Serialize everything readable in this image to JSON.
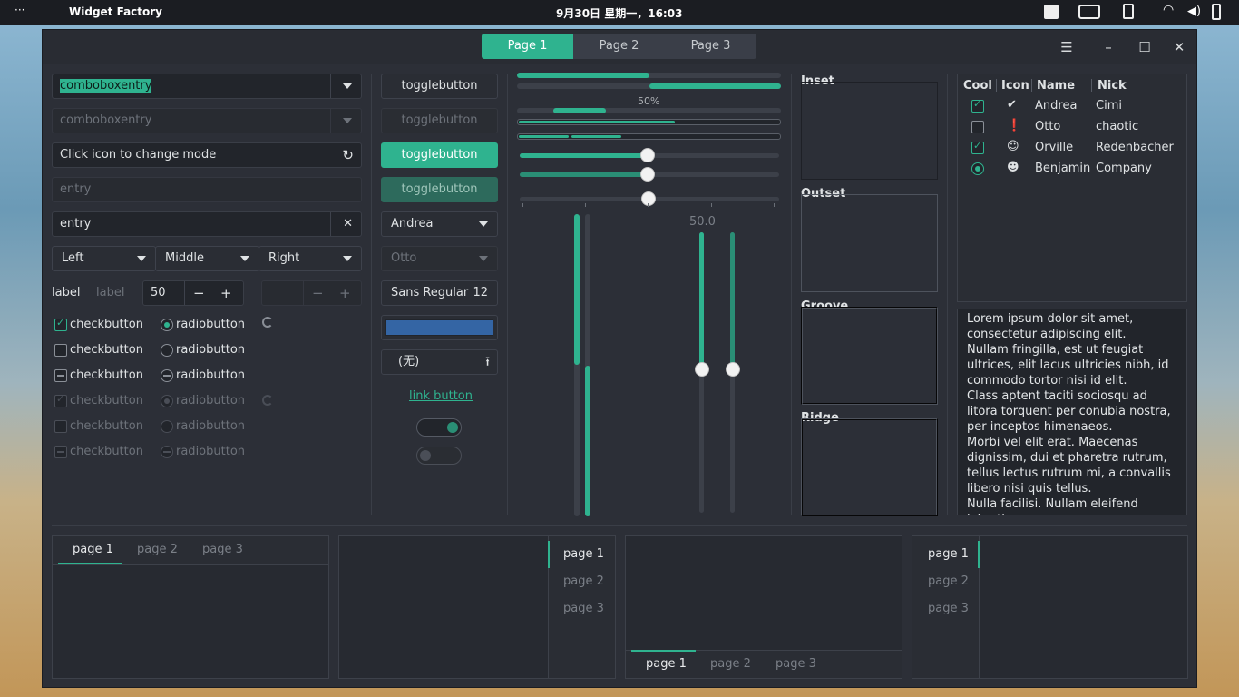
{
  "topbar": {
    "apps_label": "···",
    "app_name": "Widget Factory",
    "clock": "9月30日 星期一，16:03"
  },
  "header": {
    "stack": [
      "Page 1",
      "Page 2",
      "Page 3"
    ],
    "menu_icon": "☰",
    "min_icon": "–",
    "max_icon": "☐",
    "close_icon": "✕"
  },
  "col1": {
    "combo1": "comboboxentry",
    "combo2": "comboboxentry",
    "entry_mode": "Click icon to change mode",
    "entry_dis": "entry",
    "entry_val": "entry",
    "seg": [
      "Left",
      "Middle",
      "Right"
    ],
    "label1": "label",
    "label2": "label",
    "spin_val": "50",
    "minus": "−",
    "plus": "+",
    "checks": [
      "checkbutton",
      "checkbutton",
      "checkbutton",
      "checkbutton",
      "checkbutton",
      "checkbutton"
    ],
    "radios": [
      "radiobutton",
      "radiobutton",
      "radiobutton",
      "radiobutton",
      "radiobutton",
      "radiobutton"
    ]
  },
  "col2": {
    "toggles": [
      "togglebutton",
      "togglebutton",
      "togglebutton",
      "togglebutton"
    ],
    "combo_a": "Andrea",
    "combo_b": "Otto",
    "font": "Sans Regular",
    "font_size": "12",
    "file": "(无)",
    "link": "link button"
  },
  "col3": {
    "progress_label": "50%",
    "scale_value": "50.0",
    "progress_fraction": 0.5
  },
  "frames": {
    "inset": "Inset",
    "outset": "Outset",
    "groove": "Groove",
    "ridge": "Ridge"
  },
  "tree": {
    "headers": [
      "Cool",
      "Icon",
      "Name",
      "Nick"
    ],
    "rows": [
      {
        "name": "Andrea",
        "nick": "Cimi"
      },
      {
        "name": "Otto",
        "nick": "chaotic"
      },
      {
        "name": "Orville",
        "nick": "Redenbacher"
      },
      {
        "name": "Benjamin",
        "nick": "Company"
      }
    ]
  },
  "text": "Lorem ipsum dolor sit amet, consectetur adipiscing elit.\nNullam fringilla, est ut feugiat ultrices, elit lacus ultricies nibh, id commodo tortor nisi id elit.\nClass aptent taciti sociosqu ad litora torquent per conubia nostra, per inceptos himenaeos.\nMorbi vel elit erat. Maecenas dignissim, dui et pharetra rutrum, tellus lectus rutrum mi, a convallis libero nisi quis tellus.\nNulla facilisi. Nullam eleifend lobortis",
  "notebooks": {
    "tabs": [
      "page 1",
      "page 2",
      "page 3"
    ]
  },
  "colors": {
    "accent": "#2fb38f",
    "color_button": "#3465a4"
  }
}
